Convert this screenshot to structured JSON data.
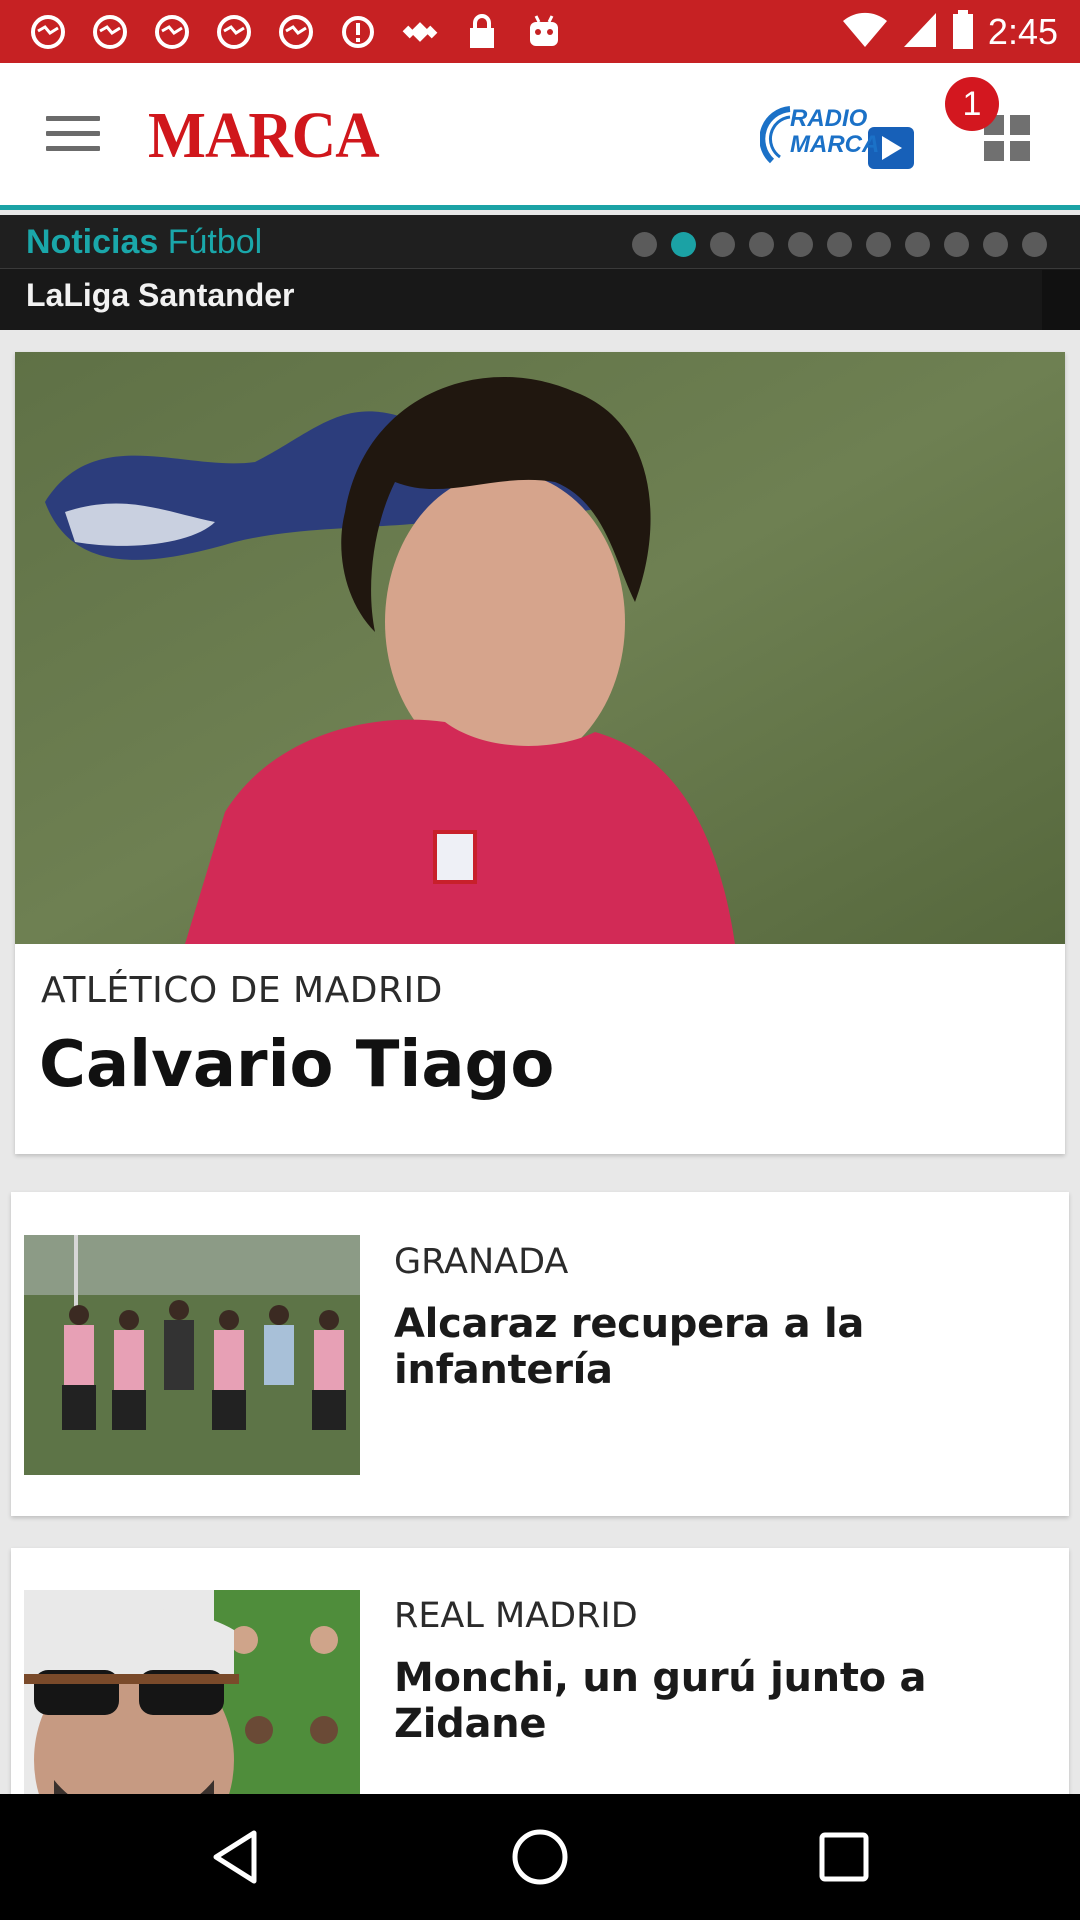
{
  "status_bar": {
    "time": "2:45",
    "notification_icons": [
      "abc-news-icon",
      "abc-news-icon",
      "abc-news-icon",
      "abc-news-icon",
      "abc-news-icon",
      "alert-icon",
      "fake-gps-icon",
      "lock-icon",
      "android-icon"
    ],
    "system_icons": [
      "wifi-icon",
      "signal-icon",
      "battery-icon"
    ]
  },
  "header": {
    "brand": "MARCA",
    "radio_label_top": "RADIO",
    "radio_label_bottom": "MARCA",
    "notification_count": "1"
  },
  "section": {
    "title_bold": "Noticias",
    "title_light": "Fútbol",
    "subtitle": "LaLiga Santander",
    "page_count": 11,
    "active_page": 1
  },
  "articles": [
    {
      "kicker": "ATLÉTICO DE MADRID",
      "title": "Calvario Tiago"
    },
    {
      "kicker": "GRANADA",
      "title": "Alcaraz recupera a la infantería"
    },
    {
      "kicker": "REAL MADRID",
      "title": "Monchi, un gurú junto a Zidane"
    }
  ],
  "colors": {
    "status_bar": "#c62123",
    "brand_red": "#d0171c",
    "accent_teal": "#1ba2a5",
    "section_bg": "#181818"
  }
}
